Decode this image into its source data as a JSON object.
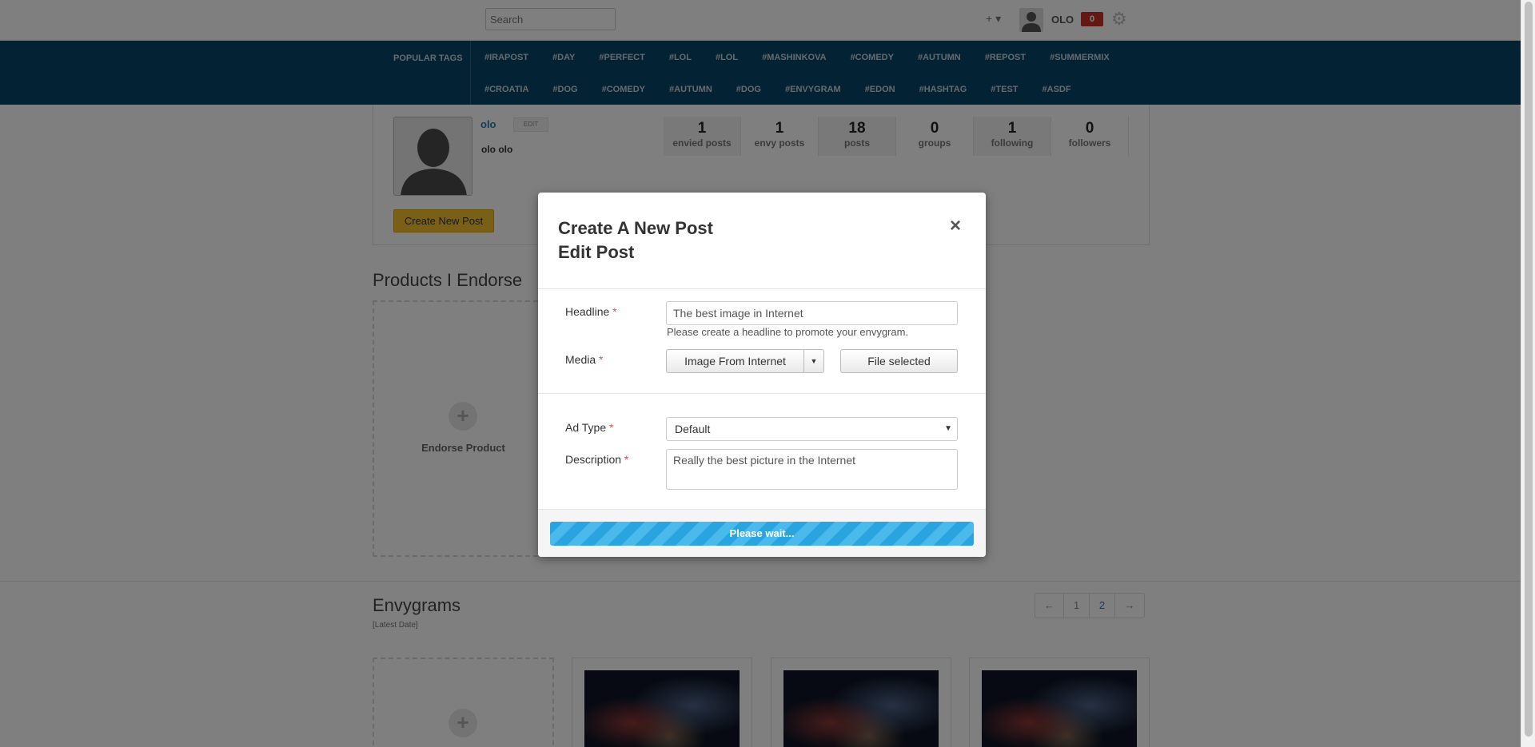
{
  "topbar": {
    "search_placeholder": "Search",
    "plus_menu": "+ ▾",
    "username": "OLO",
    "notifications": "0"
  },
  "tags": {
    "title": "POPULAR TAGS",
    "row1": [
      "#IRAPOST",
      "#DAY",
      "#PERFECT",
      "#LOL",
      "#LOL",
      "#MASHINKOVA",
      "#COMEDY",
      "#AUTUMN",
      "#REPOST",
      "#SUMMERMIX"
    ],
    "row2": [
      "#CROATIA",
      "#DOG",
      "#COMEDY",
      "#AUTUMN",
      "#DOG",
      "#ENVYGRAM",
      "#EDON",
      "#HASHTAG",
      "#TEST",
      "#ASDF"
    ]
  },
  "profile": {
    "name": "olo",
    "edit_label": "EDIT",
    "full_name": "olo olo",
    "create_button": "Create New Post",
    "stats": [
      {
        "num": "1",
        "label": "envied posts"
      },
      {
        "num": "1",
        "label": "envy posts"
      },
      {
        "num": "18",
        "label": "posts"
      },
      {
        "num": "0",
        "label": "groups"
      },
      {
        "num": "1",
        "label": "following"
      },
      {
        "num": "0",
        "label": "followers"
      }
    ]
  },
  "products": {
    "title": "Products I Endorse",
    "endorse_label": "Endorse Product"
  },
  "envygrams": {
    "title": "Envygrams",
    "subtitle": "[Latest Date]",
    "pager": {
      "prev": "←",
      "pages": [
        "1",
        "2"
      ],
      "active": "2",
      "next": "→"
    }
  },
  "modal": {
    "title_line1": "Create A New Post",
    "title_line2": "Edit Post",
    "close": "×",
    "headline_label": "Headline",
    "headline_value": "The best image in Internet",
    "headline_help": "Please create a headline to promote your envygram.",
    "media_label": "Media",
    "media_source": "Image From Internet",
    "file_button": "File selected",
    "adtype_label": "Ad Type",
    "adtype_value": "Default",
    "description_label": "Description",
    "description_value": "Really the best picture in the Internet",
    "required_mark": "*",
    "progress_text": "Please wait..."
  },
  "colors": {
    "tagsbar": "#07466b",
    "create_button": "#f4c12e",
    "notification": "#c9302c",
    "progress": "#2aa4df"
  }
}
